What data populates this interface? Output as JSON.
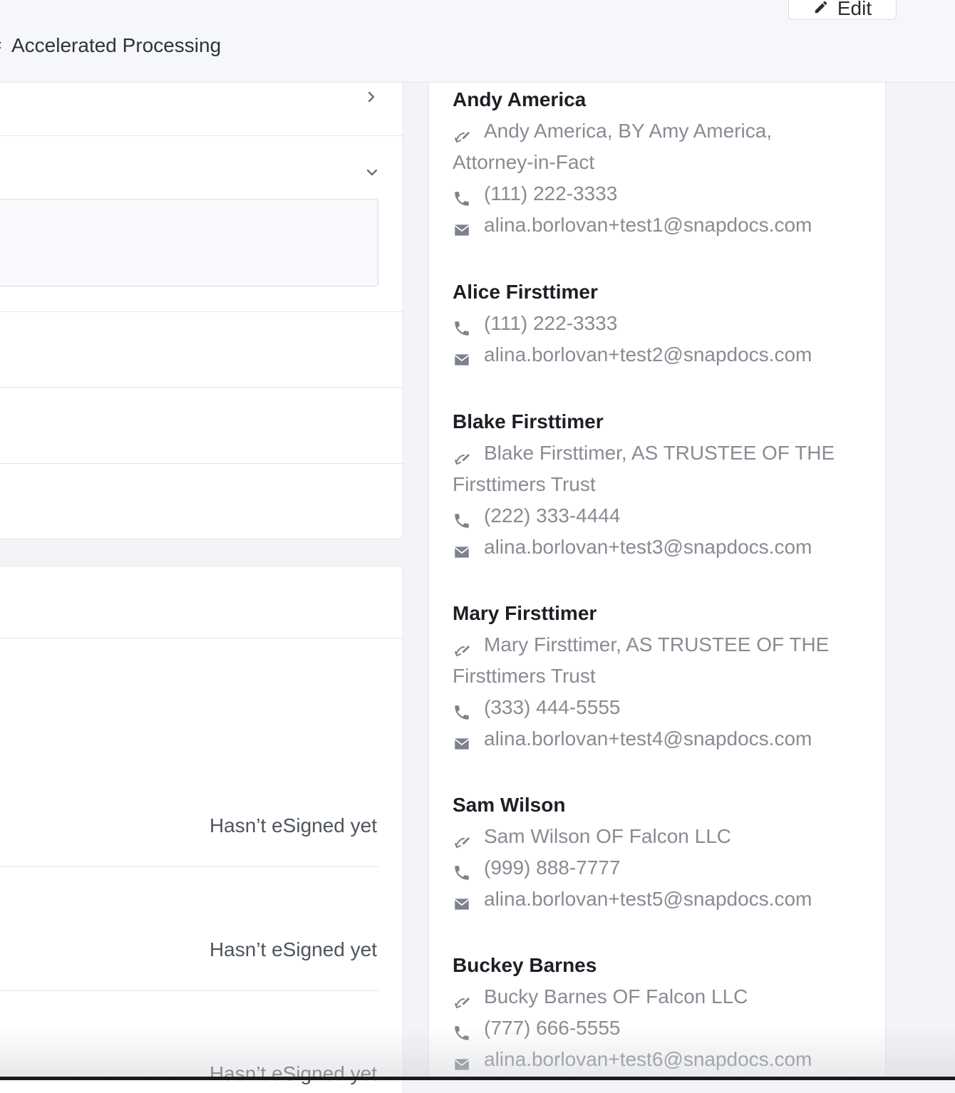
{
  "header": {
    "edit_label": "Edit",
    "accelerated_label": "Accelerated Processing"
  },
  "left": {
    "esign_status": [
      "Hasn’t eSigned yet",
      "Hasn’t eSigned yet",
      "Hasn’t eSigned yet"
    ]
  },
  "signers": [
    {
      "name": "Andy America",
      "signature": "Andy America, BY Amy America, Attorney-in-Fact",
      "phone": "(111) 222-3333",
      "email": "alina.borlovan+test1@snapdocs.com"
    },
    {
      "name": "Alice Firsttimer",
      "signature": "",
      "phone": "(111) 222-3333",
      "email": "alina.borlovan+test2@snapdocs.com"
    },
    {
      "name": "Blake Firsttimer",
      "signature": "Blake Firsttimer, AS TRUSTEE OF THE Firsttimers Trust",
      "phone": "(222) 333-4444",
      "email": "alina.borlovan+test3@snapdocs.com"
    },
    {
      "name": "Mary Firsttimer",
      "signature": "Mary Firsttimer, AS TRUSTEE OF THE Firsttimers Trust",
      "phone": "(333) 444-5555",
      "email": "alina.borlovan+test4@snapdocs.com"
    },
    {
      "name": "Sam Wilson",
      "signature": "Sam Wilson OF Falcon LLC",
      "phone": "(999) 888-7777",
      "email": "alina.borlovan+test5@snapdocs.com"
    },
    {
      "name": "Buckey Barnes",
      "signature": "Bucky Barnes OF Falcon LLC",
      "phone": "(777) 666-5555",
      "email": "alina.borlovan+test6@snapdocs.com"
    }
  ],
  "icons": {
    "signature": "signature-icon",
    "phone": "phone-icon",
    "email": "email-icon",
    "pencil": "pencil-icon",
    "chevron_right": "chevron-right-icon",
    "chevron_down": "chevron-down-icon"
  },
  "colors": {
    "text_primary": "#1c1f24",
    "text_muted": "#878c93",
    "icon": "#7d838c",
    "background": "#f3f4f7"
  }
}
